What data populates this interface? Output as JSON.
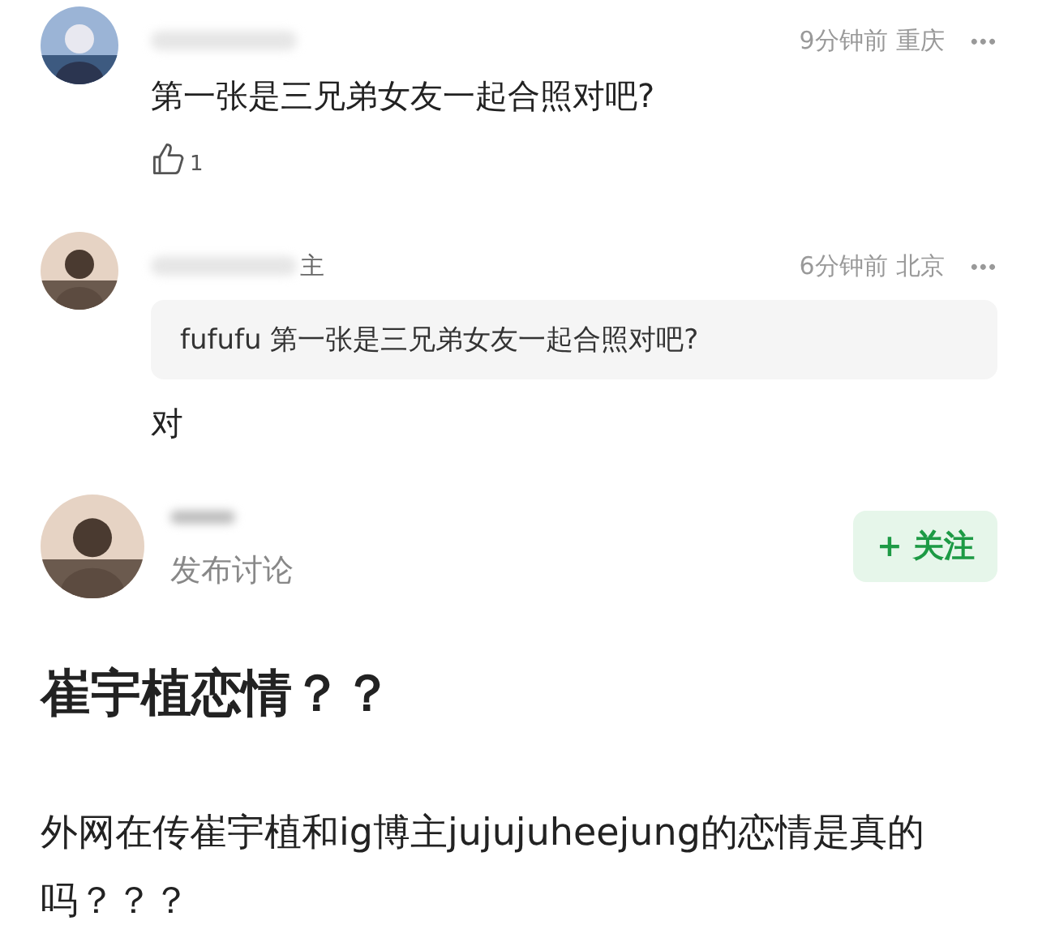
{
  "comments": [
    {
      "time": "9分钟前",
      "location": "重庆",
      "more": "•••",
      "text": "第一张是三兄弟女友一起合照对吧?",
      "likes": "1"
    },
    {
      "name_suffix": "主",
      "time": "6分钟前",
      "location": "北京",
      "more": "•••",
      "quote": {
        "user": "fufufu",
        "text": "第一张是三兄弟女友一起合照对吧?"
      },
      "text": "对"
    }
  ],
  "post": {
    "subtitle": "发布讨论",
    "follow": "+ 关注",
    "title": "崔宇植恋情？？",
    "body": "外网在传崔宇植和ig博主jujujuheejung的恋情是真的吗？？？"
  }
}
